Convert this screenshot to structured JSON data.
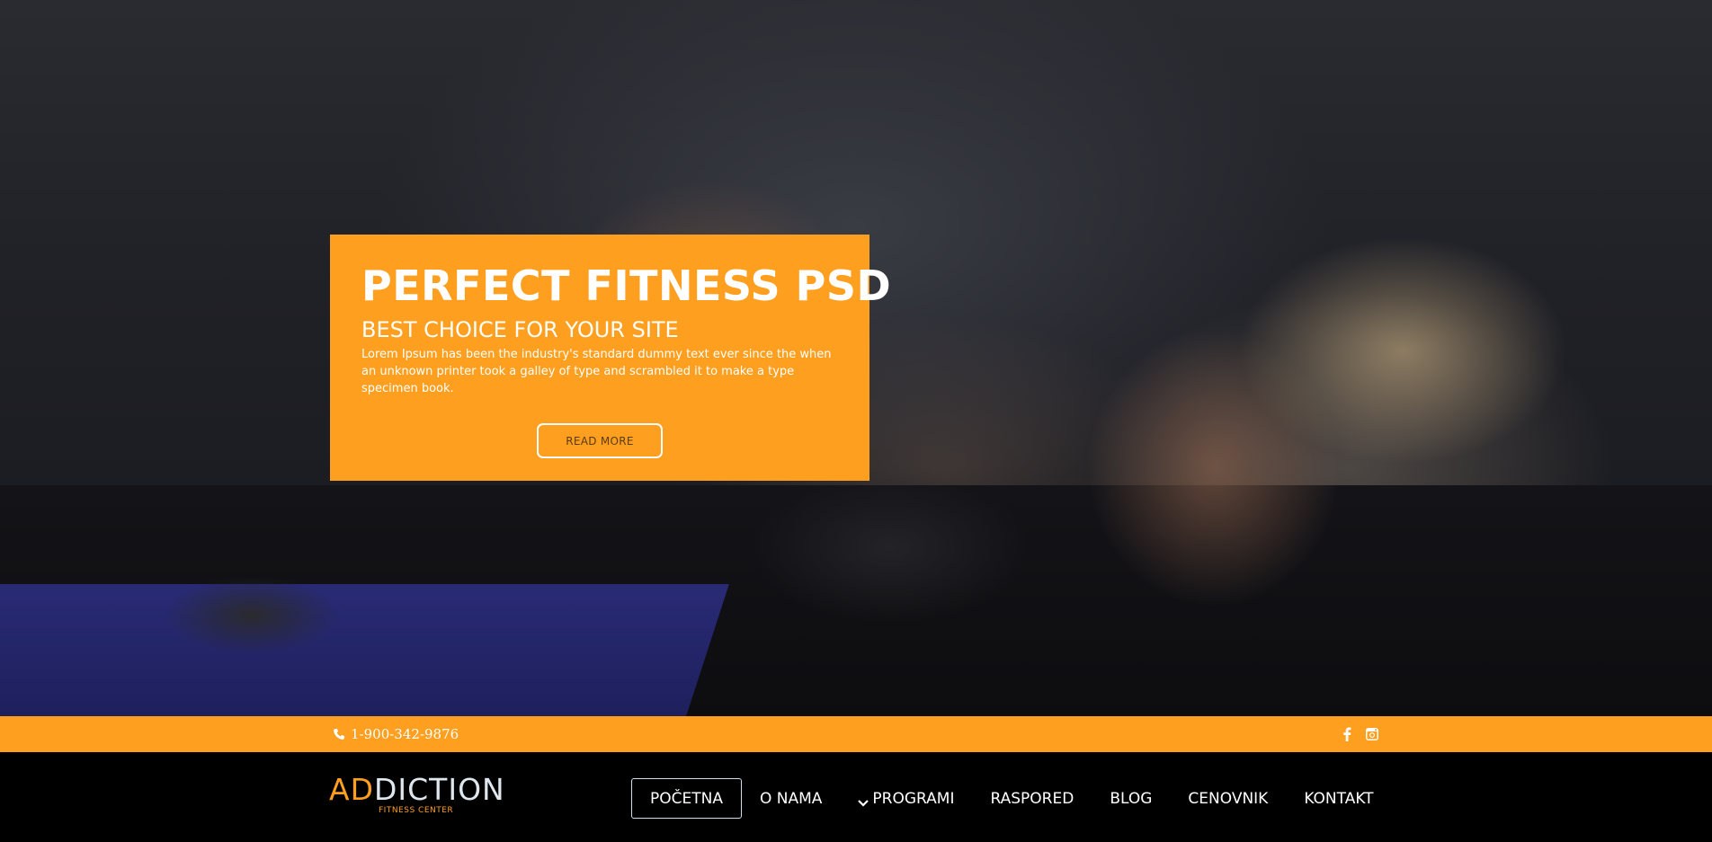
{
  "hero": {
    "title": "PERFECT FITNESS PSD",
    "subtitle": "BEST CHOICE FOR YOUR SITE",
    "text": "Lorem Ipsum has been the industry's standard dummy text ever since the when an unknown printer took a galley of type and scrambled it to make a type specimen book.",
    "button_label": "READ MORE"
  },
  "topbar": {
    "phone": "1-900-342-9876",
    "social_icons": [
      "facebook-icon",
      "instagram-icon"
    ]
  },
  "brand": {
    "logo_ad": "AD",
    "logo_rest": "DICTION",
    "tagline": "FITNESS CENTER"
  },
  "nav": {
    "items": [
      {
        "label": "POČETNA"
      },
      {
        "label": "O NAMA"
      },
      {
        "label": "PROGRAMI"
      },
      {
        "label": "RASPORED"
      },
      {
        "label": "BLOG"
      },
      {
        "label": "CENOVNIK"
      },
      {
        "label": "KONTAKT"
      }
    ]
  },
  "colors": {
    "accent": "#ff9f1f",
    "nav_bg": "#000000",
    "text": "#ffffff"
  }
}
